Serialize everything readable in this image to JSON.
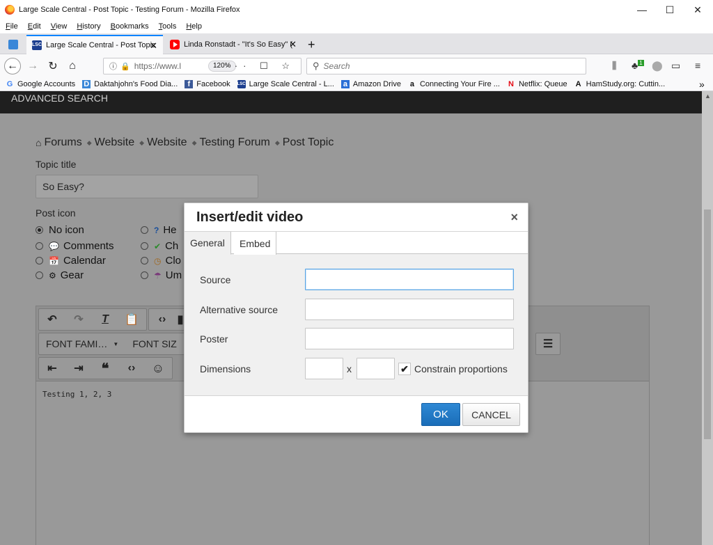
{
  "window": {
    "title": "Large Scale Central - Post Topic - Testing Forum - Mozilla Firefox",
    "minimize": "—",
    "maximize": "☐",
    "close": "✕"
  },
  "menu": [
    "File",
    "Edit",
    "View",
    "History",
    "Bookmarks",
    "Tools",
    "Help"
  ],
  "tabs": [
    {
      "label": "Large Scale Central - Post Topic",
      "favicon": "lsc-icon"
    },
    {
      "label": "Linda Ronstadt - \"It's So Easy\" (",
      "favicon": "youtube-icon"
    }
  ],
  "tab_close": "✕",
  "new_tab": "+",
  "nav": {
    "url": "https://www.l",
    "zoom": "120%",
    "search_placeholder": "Search",
    "badge": "1"
  },
  "bookmarks": [
    {
      "label": "Google Accounts",
      "icon": "G"
    },
    {
      "label": "Daktahjohn's Food Dia...",
      "icon": "D"
    },
    {
      "label": "Facebook",
      "icon": "f"
    },
    {
      "label": "Large Scale Central - L...",
      "icon": "LSC"
    },
    {
      "label": "Amazon Drive",
      "icon": "a"
    },
    {
      "label": "Connecting Your Fire ...",
      "icon": "a"
    },
    {
      "label": "Netflix: Queue",
      "icon": "N"
    },
    {
      "label": "HamStudy.org: Cuttin...",
      "icon": "A"
    }
  ],
  "page": {
    "header": "ADVANCED SEARCH",
    "breadcrumbs": [
      "Forums",
      "Website",
      "Website",
      "Testing Forum",
      "Post Topic"
    ],
    "topic_title_label": "Topic title",
    "topic_title_value": "So Easy?",
    "post_icon_label": "Post icon",
    "icons_col1": [
      "No icon",
      "Comments",
      "Calendar",
      "Gear"
    ],
    "icons_col2": [
      "He",
      "Ch",
      "Clo",
      "Um"
    ],
    "editor": {
      "font_family": "FONT FAMI…",
      "font_size": "FONT SIZ",
      "content": "Testing 1, 2, 3"
    }
  },
  "dialog": {
    "title": "Insert/edit video",
    "close": "×",
    "tabs": [
      "General",
      "Embed"
    ],
    "fields": {
      "source": "Source",
      "alt_source": "Alternative source",
      "poster": "Poster",
      "dimensions": "Dimensions",
      "x": "x",
      "constrain": "Constrain proportions"
    },
    "ok": "OK",
    "cancel": "CANCEL"
  }
}
